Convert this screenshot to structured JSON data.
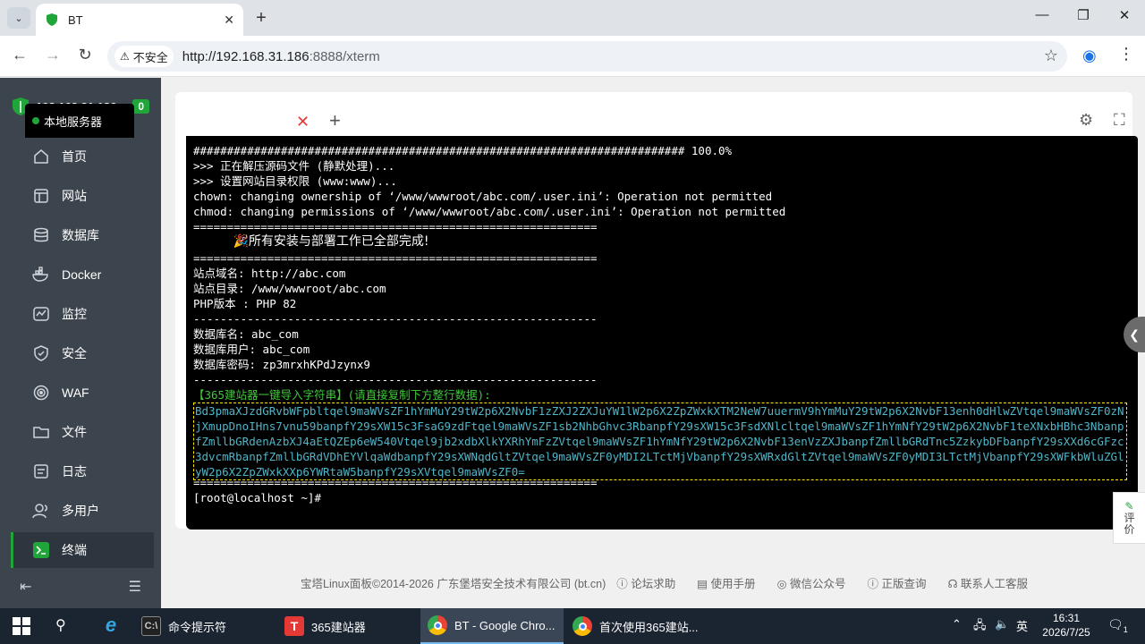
{
  "browser": {
    "tab_title": "BT",
    "security_label": "不安全",
    "url_host": "http://192.168.31.186",
    "url_path": ":8888/xterm"
  },
  "sidebar": {
    "server_ip": "192.168.31.186",
    "badge_count": "0",
    "items": [
      {
        "label": "首页",
        "icon": "home-icon"
      },
      {
        "label": "网站",
        "icon": "website-icon"
      },
      {
        "label": "数据库",
        "icon": "database-icon"
      },
      {
        "label": "Docker",
        "icon": "docker-icon"
      },
      {
        "label": "监控",
        "icon": "monitor-icon"
      },
      {
        "label": "安全",
        "icon": "shield-icon"
      },
      {
        "label": "WAF",
        "icon": "waf-icon"
      },
      {
        "label": "文件",
        "icon": "folder-icon"
      },
      {
        "label": "日志",
        "icon": "log-icon"
      },
      {
        "label": "多用户",
        "icon": "users-icon"
      },
      {
        "label": "终端",
        "icon": "terminal-icon"
      }
    ]
  },
  "terminal": {
    "tab_name": "本地服务器",
    "lines": [
      "######################################################################### 100.0%",
      ">>> 正在解压源码文件 (静默处理)...",
      ">>> 设置网站目录权限 (www:www)...",
      "chown: changing ownership of ‘/www/wwwroot/abc.com/.user.ini’: Operation not permitted",
      "chmod: changing permissions of ‘/www/wwwroot/abc.com/.user.ini’: Operation not permitted",
      "============================================================",
      "          🎉所有安装与部署工作已全部完成!",
      "============================================================",
      "站点域名: http://abc.com",
      "站点目录: /www/wwwroot/abc.com",
      "PHP版本 : PHP 82",
      "------------------------------------------------------------",
      "数据库名: abc_com",
      "数据库用户: abc_com",
      "数据库密码: zp3mrxhKPdJzynx9",
      "------------------------------------------------------------"
    ],
    "import_title": "【365建站器一键导入字符串】(请直接复制下方整行数据):",
    "import_key": "Bd3pmaXJzdGRvbWFpbltqel9maWVsZF1hYmMuY29tW2p6X2NvbF1zZXJ2ZXJuYW1lW2p6X2ZpZWxkXTM2NeW7uuermV9hYmMuY29tW2p6X2NvbF13enh0dHlwZVtqel9maWVsZF0zNjXmupDnoIHns7vnu59banpfY29sXW15c3FsaG9zdFtqel9maWVsZF1sb2NhbGhvc3RbanpfY29sXW15c3FsdXNlcltqel9maWVsZF1hYmNfY29tW2p6X2NvbF1teXNxbHBhc3NbanpfZmllbGRdenAzbXJ4aEtQZEp6eW540Vtqel9jb2xdbXlkYXRhYmFzZVtqel9maWVsZF1hYmNfY29tW2p6X2NvbF13enVzZXJbanpfZmllbGRdTnc5ZzkybDFbanpfY29sXXd6cGFzc3dvcmRbanpfZmllbGRdVDhEYVlqaWdbanpfY29sXWNqdGltZVtqel9maWVsZF0yMDI2LTctMjVbanpfY29sXWRxdGltZVtqel9maWVsZF0yMDI3LTctMjVbanpfY29sXWFkbWluZGlyW2p6X2ZpZWxkXXp6YWRtaW5banpfY29sXVtqel9maWVsZF0=",
    "end_rule": "============================================================",
    "prompt": "[root@localhost ~]#"
  },
  "feedback": {
    "line1": "评",
    "line2": "价"
  },
  "footer": {
    "copyright": "宝塔Linux面板©2014-2026 广东堡塔安全技术有限公司 (bt.cn)",
    "links": [
      "论坛求助",
      "使用手册",
      "微信公众号",
      "正版查询",
      "联系人工客服"
    ]
  },
  "taskbar": {
    "apps": [
      {
        "label": "命令提示符"
      },
      {
        "label": "365建站器"
      },
      {
        "label": "BT - Google Chro..."
      },
      {
        "label": "首次使用365建站..."
      }
    ],
    "ime": "英",
    "time": "16:31",
    "date": "2026/7/25",
    "notif_count": "1"
  },
  "colors": {
    "accent_green": "#20a53a",
    "sidebar_bg": "#3c444d",
    "terminal_bg": "#000000",
    "import_key_color": "#4fb5c8",
    "import_title_color": "#41c83a"
  }
}
